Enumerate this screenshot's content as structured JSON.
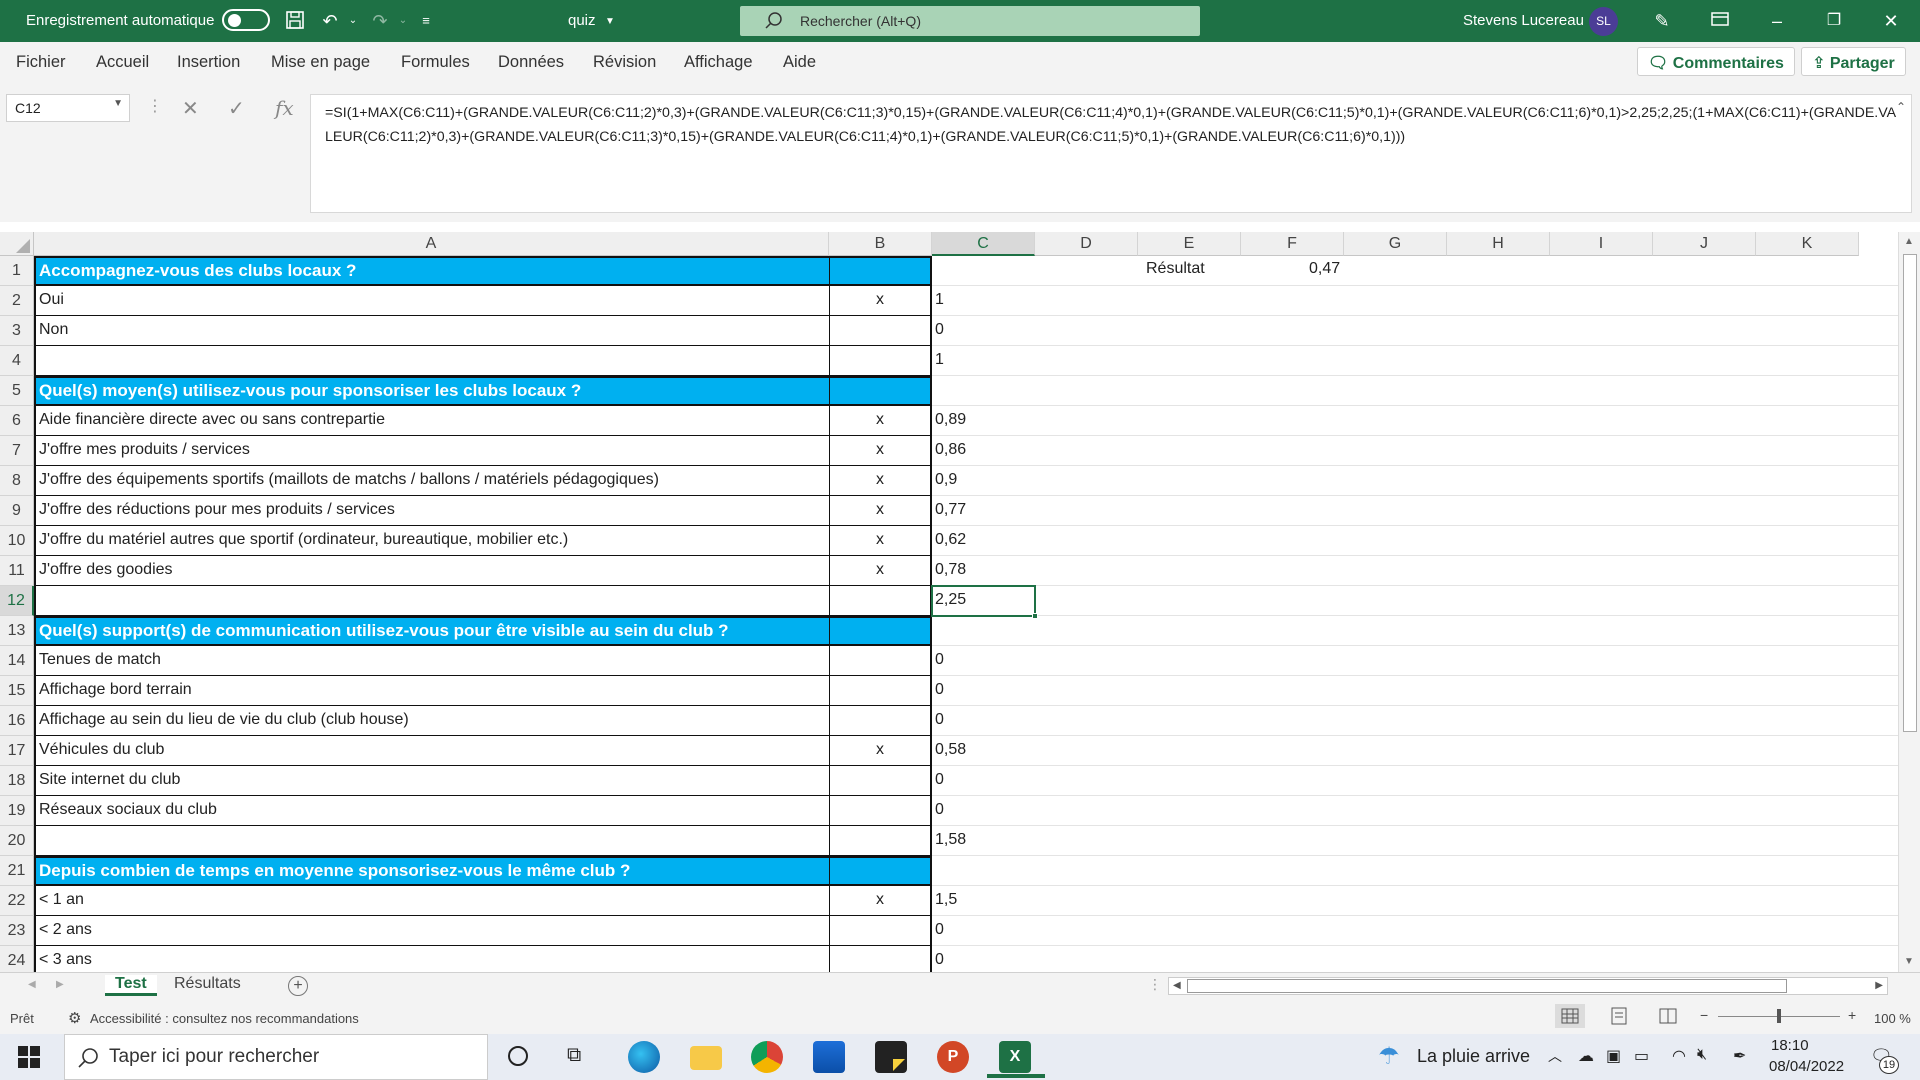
{
  "titlebar": {
    "autosave_label": "Enregistrement automatique",
    "doc_name": "quiz",
    "search_placeholder": "Rechercher (Alt+Q)",
    "user_name": "Stevens Lucereau",
    "user_initials": "SL"
  },
  "ribbon": {
    "tabs": [
      "Fichier",
      "Accueil",
      "Insertion",
      "Mise en page",
      "Formules",
      "Données",
      "Révision",
      "Affichage",
      "Aide"
    ],
    "comments_label": "Commentaires",
    "share_label": "Partager"
  },
  "formula_bar": {
    "name_box": "C12",
    "formula": "=SI(1+MAX(C6:C11)+(GRANDE.VALEUR(C6:C11;2)*0,3)+(GRANDE.VALEUR(C6:C11;3)*0,15)+(GRANDE.VALEUR(C6:C11;4)*0,1)+(GRANDE.VALEUR(C6:C11;5)*0,1)+(GRANDE.VALEUR(C6:C11;6)*0,1)>2,25;2,25;(1+MAX(C6:C11)+(GRANDE.VALEUR(C6:C11;2)*0,3)+(GRANDE.VALEUR(C6:C11;3)*0,15)+(GRANDE.VALEUR(C6:C11;4)*0,1)+(GRANDE.VALEUR(C6:C11;5)*0,1)+(GRANDE.VALEUR(C6:C11;6)*0,1)))"
  },
  "columns": [
    "A",
    "B",
    "C",
    "D",
    "E",
    "F",
    "G",
    "H",
    "I",
    "J",
    "K"
  ],
  "rows": [
    {
      "n": "1",
      "type": "q",
      "a": "Accompagnez-vous des clubs locaux ?",
      "b": "",
      "c": ""
    },
    {
      "n": "2",
      "type": "opt",
      "a": "Oui",
      "b": "x",
      "c": "1"
    },
    {
      "n": "3",
      "type": "opt",
      "a": "Non",
      "b": "",
      "c": "0"
    },
    {
      "n": "4",
      "type": "total",
      "a": "",
      "b": "",
      "c": "1"
    },
    {
      "n": "5",
      "type": "q",
      "a": "Quel(s) moyen(s) utilisez-vous pour sponsoriser les clubs locaux ?",
      "b": "",
      "c": ""
    },
    {
      "n": "6",
      "type": "opt",
      "a": "Aide financière directe avec ou sans contrepartie",
      "b": "x",
      "c": "0,89"
    },
    {
      "n": "7",
      "type": "opt",
      "a": "J'offre mes produits / services",
      "b": "x",
      "c": "0,86"
    },
    {
      "n": "8",
      "type": "opt",
      "a": "J'offre des équipements sportifs (maillots de matchs / ballons / matériels pédagogiques)",
      "b": "x",
      "c": "0,9"
    },
    {
      "n": "9",
      "type": "opt",
      "a": "J'offre des réductions pour mes produits / services",
      "b": "x",
      "c": "0,77"
    },
    {
      "n": "10",
      "type": "opt",
      "a": "J'offre du matériel autres que sportif (ordinateur, bureautique, mobilier etc.)",
      "b": "x",
      "c": "0,62"
    },
    {
      "n": "11",
      "type": "opt",
      "a": "J'offre des goodies",
      "b": "x",
      "c": "0,78"
    },
    {
      "n": "12",
      "type": "total",
      "a": "",
      "b": "",
      "c": "2,25"
    },
    {
      "n": "13",
      "type": "q",
      "a": "Quel(s) support(s) de communication utilisez-vous pour être visible au sein du club ?",
      "b": "",
      "c": ""
    },
    {
      "n": "14",
      "type": "opt",
      "a": "Tenues de match",
      "b": "",
      "c": "0"
    },
    {
      "n": "15",
      "type": "opt",
      "a": "Affichage bord terrain",
      "b": "",
      "c": "0"
    },
    {
      "n": "16",
      "type": "opt",
      "a": "Affichage au sein du lieu de vie du club (club house)",
      "b": "",
      "c": "0"
    },
    {
      "n": "17",
      "type": "opt",
      "a": "Véhicules du club",
      "b": "x",
      "c": "0,58"
    },
    {
      "n": "18",
      "type": "opt",
      "a": "Site internet du club",
      "b": "",
      "c": "0"
    },
    {
      "n": "19",
      "type": "opt",
      "a": "Réseaux sociaux du club",
      "b": "",
      "c": "0"
    },
    {
      "n": "20",
      "type": "total",
      "a": "",
      "b": "",
      "c": "1,58"
    },
    {
      "n": "21",
      "type": "q",
      "a": "Depuis combien de temps en moyenne sponsorisez-vous le même club ?",
      "b": "",
      "c": ""
    },
    {
      "n": "22",
      "type": "opt",
      "a": "< 1 an",
      "b": "x",
      "c": "1,5"
    },
    {
      "n": "23",
      "type": "opt",
      "a": "< 2 ans",
      "b": "",
      "c": "0"
    },
    {
      "n": "24",
      "type": "opt",
      "a": "< 3 ans",
      "b": "",
      "c": "0"
    }
  ],
  "result": {
    "label": "Résultat",
    "value": "0,47"
  },
  "selected_cell": {
    "col": "C",
    "row": "12"
  },
  "sheets": {
    "tabs": [
      "Test",
      "Résultats"
    ],
    "active": "Test"
  },
  "status": {
    "ready": "Prêt",
    "accessibility": "Accessibilité : consultez nos recommandations",
    "zoom": "100 %"
  },
  "taskbar": {
    "search_placeholder": "Taper ici pour rechercher",
    "weather": "La pluie arrive",
    "time": "18:10",
    "date": "08/04/2022",
    "notification_count": "19"
  },
  "colors": {
    "excel_green": "#1e7145",
    "question_blue": "#00b0f0"
  }
}
